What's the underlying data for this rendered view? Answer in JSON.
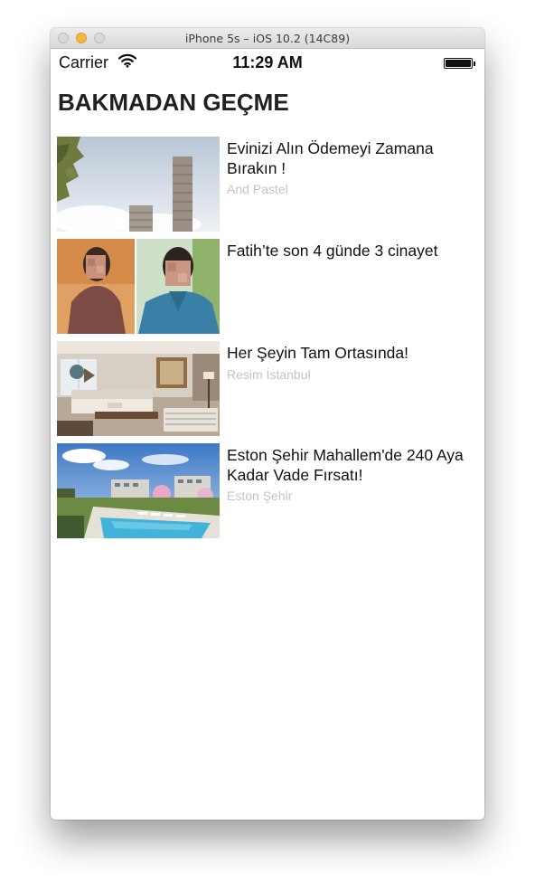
{
  "window": {
    "title": "iPhone 5s – iOS 10.2 (14C89)"
  },
  "status_bar": {
    "carrier": "Carrier",
    "time": "11:29 AM"
  },
  "section": {
    "title": "BAKMADAN GEÇME"
  },
  "news": [
    {
      "title": "Evinizi Alın Ödemeyi Zamana Bırakın !",
      "source": "And Pastel",
      "image": "skyscrapers-photo"
    },
    {
      "title": "Fatih’te son 4 günde 3 cinayet",
      "source": "",
      "image": "blurred-faces-photo"
    },
    {
      "title": "Her Şeyin Tam Ortasında!",
      "source": "Resim İstanbul",
      "image": "living-room-photo"
    },
    {
      "title": "Eston Şehir Mahallem'de 240 Aya Kadar Vade Fırsatı!",
      "source": "Eston Şehir",
      "image": "pool-residence-photo"
    }
  ]
}
